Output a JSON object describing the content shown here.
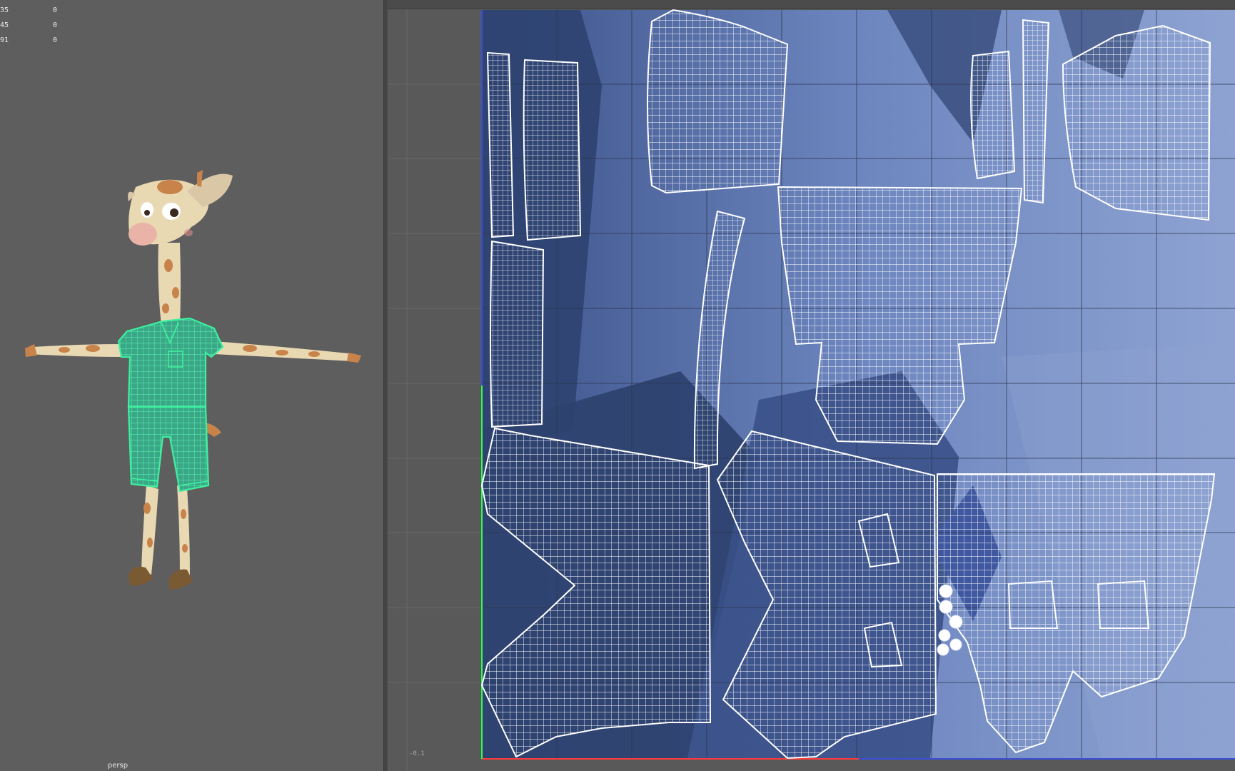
{
  "stats": [
    {
      "label": "35",
      "value": "0"
    },
    {
      "label": "45",
      "value": "0"
    },
    {
      "label": "91",
      "value": "0"
    }
  ],
  "persp_viewport": {
    "camera_label": "persp",
    "wireframe_color": "#3df0a0",
    "mesh_color": "#3aa886",
    "character_skin": "#e9d9b3",
    "spot_color": "#c8834a"
  },
  "uv_editor": {
    "axis_tick": "-0.1",
    "tile_colors": {
      "dark": "#2e4270",
      "mid": "#5a74ae",
      "light": "#8ea3d2"
    },
    "wire_color": "#ffffff",
    "u_axis_color": "#ff3b3b",
    "v_axis_color": "#2cff4f"
  }
}
